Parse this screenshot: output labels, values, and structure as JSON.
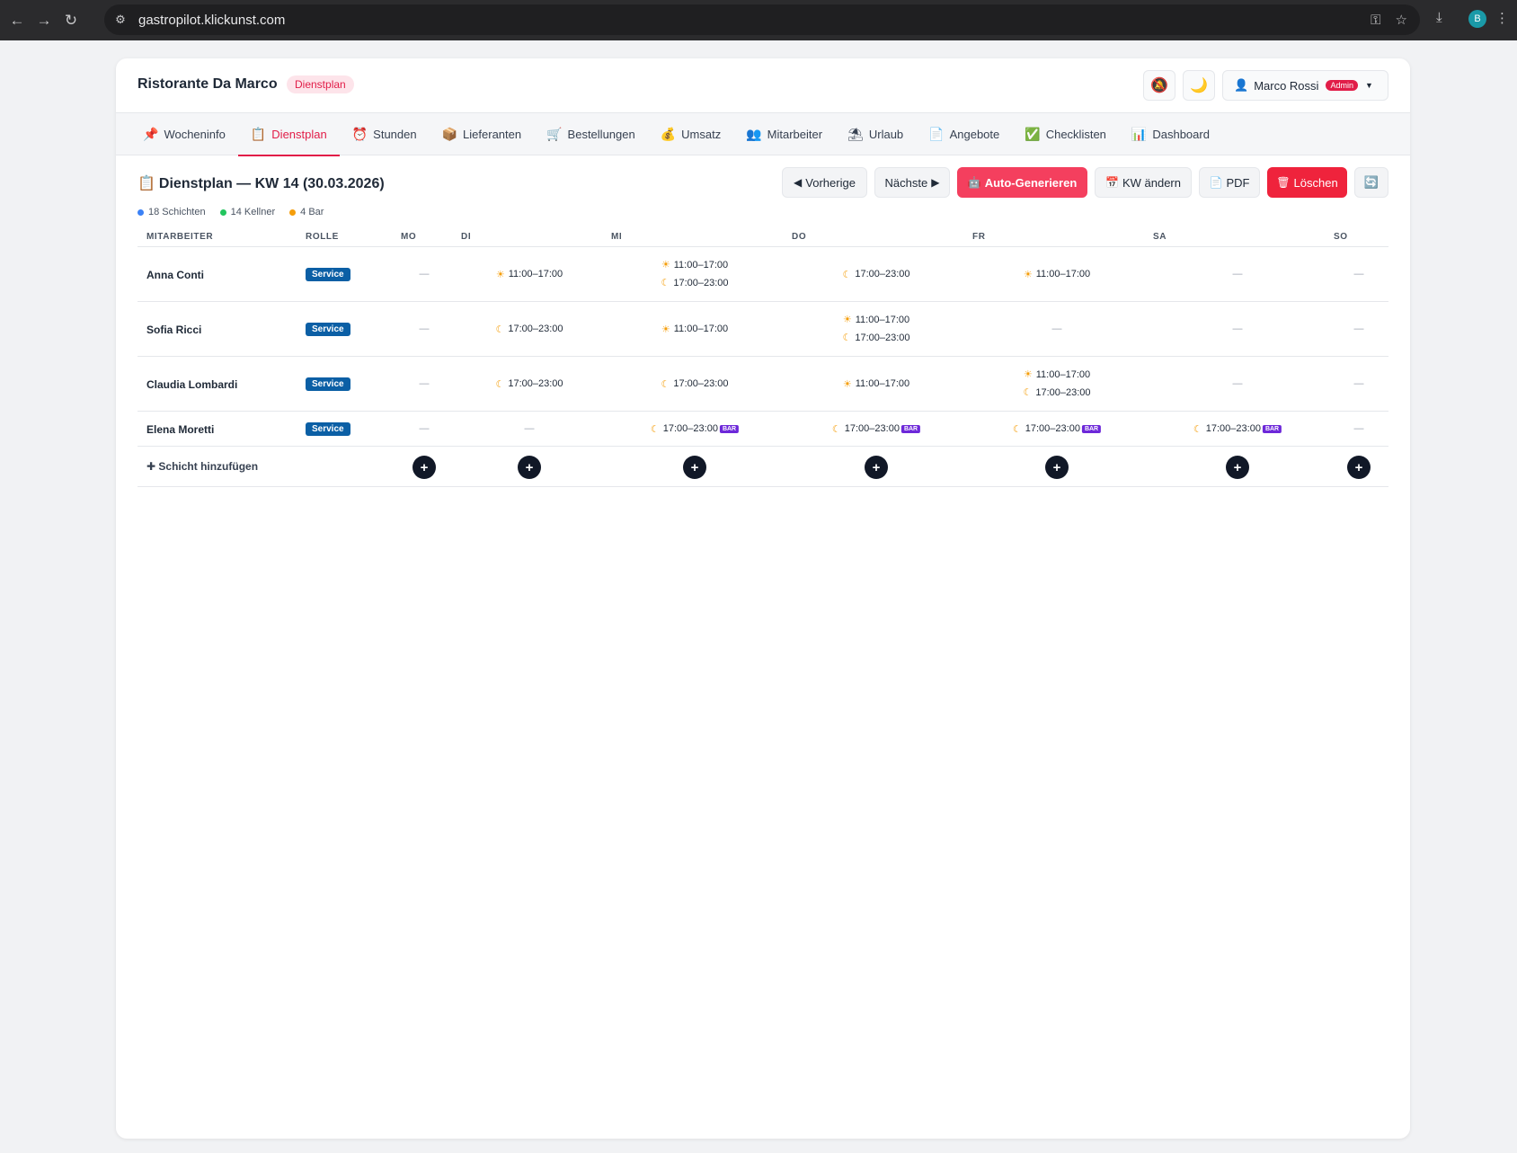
{
  "browser": {
    "url": "gastropilot.klickunst.com",
    "profile_initial": "B"
  },
  "header": {
    "brand": "Ristorante Da Marco",
    "badge": "Dienstplan",
    "user_name": "Marco Rossi",
    "user_role": "Admin"
  },
  "tabs": [
    {
      "icon": "📌",
      "label": "Wocheninfo"
    },
    {
      "icon": "📋",
      "label": "Dienstplan"
    },
    {
      "icon": "⏰",
      "label": "Stunden"
    },
    {
      "icon": "📦",
      "label": "Lieferanten"
    },
    {
      "icon": "🛒",
      "label": "Bestellungen"
    },
    {
      "icon": "💰",
      "label": "Umsatz"
    },
    {
      "icon": "👥",
      "label": "Mitarbeiter"
    },
    {
      "icon": "⛱",
      "label": "Urlaub"
    },
    {
      "icon": "📄",
      "label": "Angebote"
    },
    {
      "icon": "✅",
      "label": "Checklisten"
    },
    {
      "icon": "📊",
      "label": "Dashboard"
    }
  ],
  "page": {
    "title": "Dienstplan — KW 14 (30.03.2026)",
    "actions": {
      "prev": "Vorherige",
      "next": "Nächste",
      "auto": "Auto-Generieren",
      "kw": "KW ändern",
      "pdf": "PDF",
      "delete": "Löschen"
    },
    "stats": [
      {
        "label": "18 Schichten",
        "color": "#3b82f6"
      },
      {
        "label": "14 Kellner",
        "color": "#22c55e"
      },
      {
        "label": "4 Bar",
        "color": "#f59e0b"
      }
    ]
  },
  "table": {
    "columns": [
      "MITARBEITER",
      "ROLLE",
      "MO",
      "DI",
      "MI",
      "DO",
      "FR",
      "SA",
      "SO"
    ],
    "rows": [
      {
        "name": "Anna Conti",
        "role": "Service",
        "days": [
          [],
          [
            {
              "type": "sun",
              "time": "11:00–17:00"
            }
          ],
          [
            {
              "type": "sun",
              "time": "11:00–17:00"
            },
            {
              "type": "moon",
              "time": "17:00–23:00"
            }
          ],
          [
            {
              "type": "moon",
              "time": "17:00–23:00"
            }
          ],
          [
            {
              "type": "sun",
              "time": "11:00–17:00"
            }
          ],
          [],
          []
        ]
      },
      {
        "name": "Sofia Ricci",
        "role": "Service",
        "days": [
          [],
          [
            {
              "type": "moon",
              "time": "17:00–23:00"
            }
          ],
          [
            {
              "type": "sun",
              "time": "11:00–17:00"
            }
          ],
          [
            {
              "type": "sun",
              "time": "11:00–17:00"
            },
            {
              "type": "moon",
              "time": "17:00–23:00"
            }
          ],
          [],
          [],
          []
        ]
      },
      {
        "name": "Claudia Lombardi",
        "role": "Service",
        "days": [
          [],
          [
            {
              "type": "moon",
              "time": "17:00–23:00"
            }
          ],
          [
            {
              "type": "moon",
              "time": "17:00–23:00"
            }
          ],
          [
            {
              "type": "sun",
              "time": "11:00–17:00"
            }
          ],
          [
            {
              "type": "sun",
              "time": "11:00–17:00"
            },
            {
              "type": "moon",
              "time": "17:00–23:00"
            }
          ],
          [],
          []
        ]
      },
      {
        "name": "Elena Moretti",
        "role": "Service",
        "days": [
          [],
          [],
          [
            {
              "type": "moon",
              "time": "17:00–23:00",
              "bar": "BAR"
            }
          ],
          [
            {
              "type": "moon",
              "time": "17:00–23:00",
              "bar": "BAR"
            }
          ],
          [
            {
              "type": "moon",
              "time": "17:00–23:00",
              "bar": "BAR"
            }
          ],
          [
            {
              "type": "moon",
              "time": "17:00–23:00",
              "bar": "BAR"
            }
          ],
          []
        ]
      }
    ],
    "empty": "—",
    "add_label": "Schicht hinzufügen"
  }
}
